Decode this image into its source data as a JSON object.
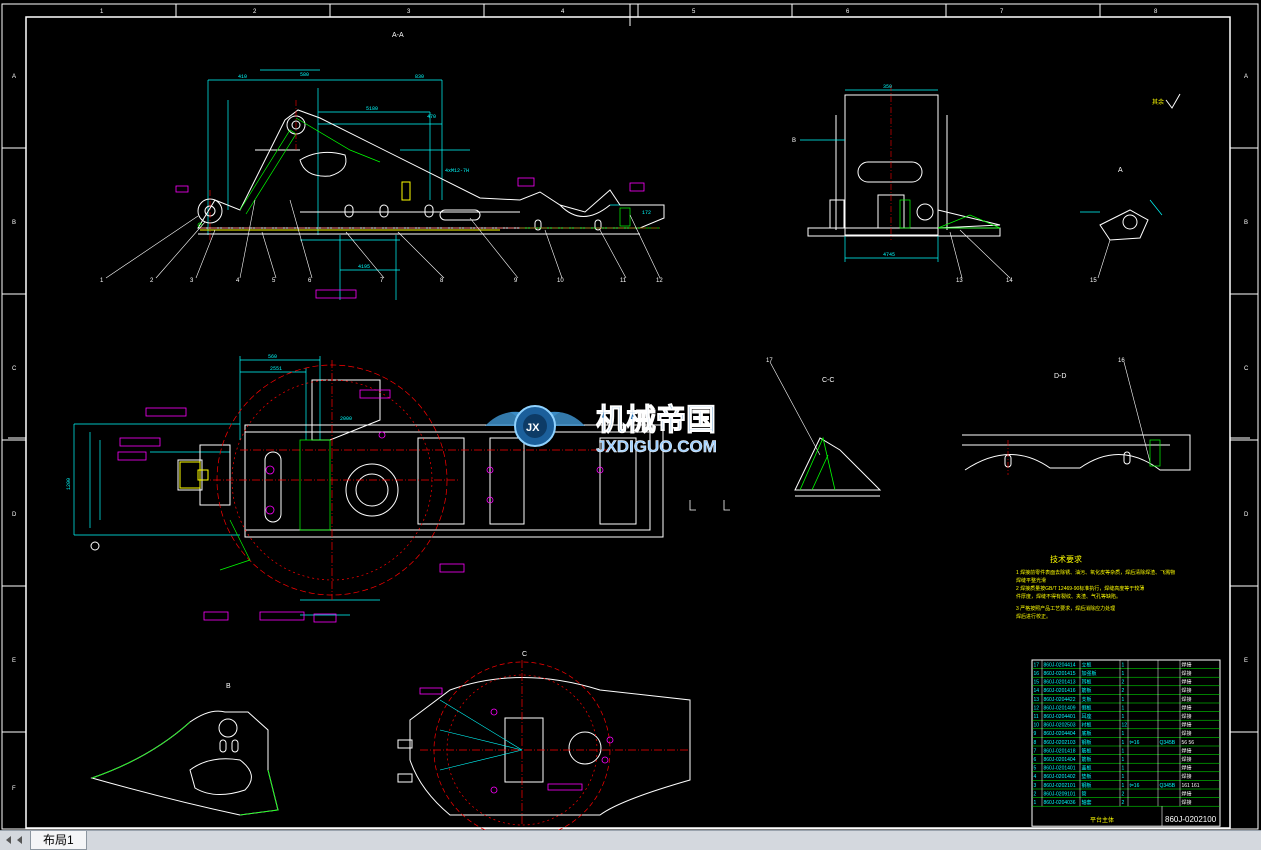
{
  "border": {
    "top_columns": [
      "1",
      "2",
      "3",
      "4",
      "5",
      "6",
      "7",
      "8"
    ],
    "side_rows": [
      "A",
      "B",
      "C",
      "D",
      "E",
      "F"
    ]
  },
  "section_titles": {
    "front": "A-A",
    "section_a": "A",
    "section_b_marker": "B",
    "view_b": "B",
    "view_c": "C",
    "section_cc": "C-C",
    "section_dd": "D-D",
    "roughness": "其余"
  },
  "balloons_top": [
    "1",
    "2",
    "3",
    "4",
    "5",
    "6",
    "7",
    "8",
    "9",
    "10",
    "11",
    "12",
    "13",
    "14",
    "15"
  ],
  "balloons_mid": [
    "17",
    "16"
  ],
  "dims": {
    "d1": "830",
    "d2": "410",
    "d3": "5180",
    "d4": "470",
    "d5": "580",
    "d6": "2000",
    "d7": "4xM12-7H",
    "d8": "4195",
    "d9": "560",
    "d10": "2551",
    "d11": "350",
    "d12": "1200",
    "d13": "4745",
    "d14": "172"
  },
  "watermark": {
    "cn": "机械帝国",
    "en": "JXDIGUO.COM",
    "badge": "JX"
  },
  "tech_req": {
    "title": "技术要求",
    "lines": [
      "1 焊接前零件表面去除锈、油污、氧化皮等杂质，焊后清除焊渣、飞溅物",
      "  焊缝平整光滑",
      "2 焊接质量按GB/T 12469-90标准执行，焊缝高度等于较薄",
      "  件厚度，焊缝不得有裂纹、夹渣、气孔等缺陷。",
      "3 严格按照产品工艺要求，焊后消除应力处理",
      "  焊后进行校正。"
    ]
  },
  "bom": {
    "rows": [
      [
        "17",
        "860J-0204414",
        "立板",
        "1",
        "",
        "",
        "焊接"
      ],
      [
        "16",
        "860J-0201415",
        "加强板",
        "1",
        "",
        "",
        "焊接"
      ],
      [
        "15",
        "860J-0201413",
        "耳板",
        "2",
        "",
        "",
        "焊接"
      ],
      [
        "14",
        "860J-0201416",
        "筋板",
        "2",
        "",
        "",
        "焊接"
      ],
      [
        "13",
        "860J-0204422",
        "支板",
        "1",
        "",
        "",
        "焊接"
      ],
      [
        "12",
        "860J-0201409",
        "侧板",
        "1",
        "",
        "",
        "焊接"
      ],
      [
        "11",
        "860J-0204401",
        "耳座",
        "1",
        "",
        "",
        "焊接"
      ],
      [
        "10",
        "860J-0202503",
        "衬板",
        "12",
        "",
        "",
        "焊接"
      ],
      [
        "9",
        "860J-0204404",
        "底板",
        "1",
        "",
        "",
        "焊接"
      ],
      [
        "8",
        "860J-0202103",
        "钢板",
        "1",
        "t=16",
        "Q345B",
        "56  56"
      ],
      [
        "7",
        "860J-0201418",
        "筋板",
        "1",
        "",
        "",
        "焊接"
      ],
      [
        "6",
        "860J-0201404",
        "筋板",
        "1",
        "",
        "",
        "焊接"
      ],
      [
        "5",
        "860J-0201401",
        "盖板",
        "1",
        "",
        "",
        "焊接"
      ],
      [
        "4",
        "860J-0201402",
        "垫板",
        "1",
        "",
        "",
        "焊接"
      ],
      [
        "3",
        "860J-0202101",
        "钢板",
        "1",
        "t=16",
        "Q345B",
        "161  161"
      ],
      [
        "2",
        "860J-0209101",
        "管",
        "2",
        "",
        "",
        "焊接"
      ],
      [
        "1",
        "860J-0204036",
        "轴套",
        "2",
        "",
        "",
        "焊接"
      ]
    ],
    "name": "平台主体",
    "drawing_no": "860J-0202100"
  },
  "tabs": [
    {
      "label": "布局1"
    }
  ],
  "colors": {
    "background": "#000000",
    "outline": "#ffffff",
    "dimension": "#00ffff",
    "hatch": "#00ff00",
    "center": "#ff0000",
    "magenta": "#ff00ff",
    "yellow": "#ffff00",
    "bom_text": "#00ffff"
  }
}
